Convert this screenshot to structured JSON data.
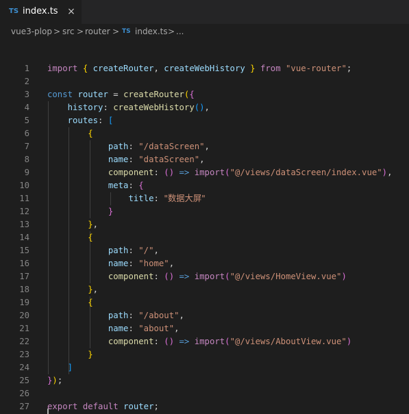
{
  "tab": {
    "badge": "TS",
    "title": "index.ts",
    "close_icon": "×"
  },
  "breadcrumb": {
    "items": [
      "vue3-plop",
      "src",
      "router"
    ],
    "file_badge": "TS",
    "file": "index.ts",
    "trailing": "...",
    "separator": ">"
  },
  "editor": {
    "lines": [
      [
        [
          "t-keyword",
          "import"
        ],
        [
          "t-punct",
          " "
        ],
        [
          "t-brace1",
          "{"
        ],
        [
          "t-punct",
          " "
        ],
        [
          "t-variable",
          "createRouter"
        ],
        [
          "t-punct",
          ", "
        ],
        [
          "t-variable",
          "createWebHistory"
        ],
        [
          "t-punct",
          " "
        ],
        [
          "t-brace1",
          "}"
        ],
        [
          "t-punct",
          " "
        ],
        [
          "t-keyword",
          "from"
        ],
        [
          "t-punct",
          " "
        ],
        [
          "t-string",
          "\"vue-router\""
        ],
        [
          "t-punct",
          ";"
        ]
      ],
      [],
      [
        [
          "t-storage",
          "const"
        ],
        [
          "t-punct",
          " "
        ],
        [
          "t-variable",
          "router"
        ],
        [
          "t-punct",
          " = "
        ],
        [
          "t-function",
          "createRouter"
        ],
        [
          "t-brace1",
          "("
        ],
        [
          "t-brace2",
          "{"
        ]
      ],
      [
        [
          "t-punct",
          "    "
        ],
        [
          "t-variable",
          "history"
        ],
        [
          "t-punct",
          ": "
        ],
        [
          "t-function",
          "createWebHistory"
        ],
        [
          "t-brace3",
          "()"
        ],
        [
          "t-punct",
          ","
        ]
      ],
      [
        [
          "t-punct",
          "    "
        ],
        [
          "t-variable",
          "routes"
        ],
        [
          "t-punct",
          ": "
        ],
        [
          "t-brace3",
          "["
        ]
      ],
      [
        [
          "t-punct",
          "        "
        ],
        [
          "t-brace1",
          "{"
        ]
      ],
      [
        [
          "t-punct",
          "            "
        ],
        [
          "t-variable",
          "path"
        ],
        [
          "t-punct",
          ": "
        ],
        [
          "t-string",
          "\"/dataScreen\""
        ],
        [
          "t-punct",
          ","
        ]
      ],
      [
        [
          "t-punct",
          "            "
        ],
        [
          "t-variable",
          "name"
        ],
        [
          "t-punct",
          ": "
        ],
        [
          "t-string",
          "\"dataScreen\""
        ],
        [
          "t-punct",
          ","
        ]
      ],
      [
        [
          "t-punct",
          "            "
        ],
        [
          "t-function",
          "component"
        ],
        [
          "t-punct",
          ": "
        ],
        [
          "t-brace2",
          "()"
        ],
        [
          "t-punct",
          " "
        ],
        [
          "t-arrow",
          "=>"
        ],
        [
          "t-punct",
          " "
        ],
        [
          "t-keyword",
          "import"
        ],
        [
          "t-brace2",
          "("
        ],
        [
          "t-string",
          "\"@/views/dataScreen/index.vue\""
        ],
        [
          "t-brace2",
          ")"
        ],
        [
          "t-punct",
          ","
        ]
      ],
      [
        [
          "t-punct",
          "            "
        ],
        [
          "t-variable",
          "meta"
        ],
        [
          "t-punct",
          ": "
        ],
        [
          "t-brace2",
          "{"
        ]
      ],
      [
        [
          "t-punct",
          "                "
        ],
        [
          "t-variable",
          "title"
        ],
        [
          "t-punct",
          ": "
        ],
        [
          "t-string t-cjk",
          "\"数据大屏\""
        ]
      ],
      [
        [
          "t-punct",
          "            "
        ],
        [
          "t-brace2",
          "}"
        ]
      ],
      [
        [
          "t-punct",
          "        "
        ],
        [
          "t-brace1",
          "}"
        ],
        [
          "t-punct",
          ","
        ]
      ],
      [
        [
          "t-punct",
          "        "
        ],
        [
          "t-brace1",
          "{"
        ]
      ],
      [
        [
          "t-punct",
          "            "
        ],
        [
          "t-variable",
          "path"
        ],
        [
          "t-punct",
          ": "
        ],
        [
          "t-string",
          "\"/\""
        ],
        [
          "t-punct",
          ","
        ]
      ],
      [
        [
          "t-punct",
          "            "
        ],
        [
          "t-variable",
          "name"
        ],
        [
          "t-punct",
          ": "
        ],
        [
          "t-string",
          "\"home\""
        ],
        [
          "t-punct",
          ","
        ]
      ],
      [
        [
          "t-punct",
          "            "
        ],
        [
          "t-function",
          "component"
        ],
        [
          "t-punct",
          ": "
        ],
        [
          "t-brace2",
          "()"
        ],
        [
          "t-punct",
          " "
        ],
        [
          "t-arrow",
          "=>"
        ],
        [
          "t-punct",
          " "
        ],
        [
          "t-keyword",
          "import"
        ],
        [
          "t-brace2",
          "("
        ],
        [
          "t-string",
          "\"@/views/HomeView.vue\""
        ],
        [
          "t-brace2",
          ")"
        ]
      ],
      [
        [
          "t-punct",
          "        "
        ],
        [
          "t-brace1",
          "}"
        ],
        [
          "t-punct",
          ","
        ]
      ],
      [
        [
          "t-punct",
          "        "
        ],
        [
          "t-brace1",
          "{"
        ]
      ],
      [
        [
          "t-punct",
          "            "
        ],
        [
          "t-variable",
          "path"
        ],
        [
          "t-punct",
          ": "
        ],
        [
          "t-string",
          "\"/about\""
        ],
        [
          "t-punct",
          ","
        ]
      ],
      [
        [
          "t-punct",
          "            "
        ],
        [
          "t-variable",
          "name"
        ],
        [
          "t-punct",
          ": "
        ],
        [
          "t-string",
          "\"about\""
        ],
        [
          "t-punct",
          ","
        ]
      ],
      [
        [
          "t-punct",
          "            "
        ],
        [
          "t-function",
          "component"
        ],
        [
          "t-punct",
          ": "
        ],
        [
          "t-brace2",
          "()"
        ],
        [
          "t-punct",
          " "
        ],
        [
          "t-arrow",
          "=>"
        ],
        [
          "t-punct",
          " "
        ],
        [
          "t-keyword",
          "import"
        ],
        [
          "t-brace2",
          "("
        ],
        [
          "t-string",
          "\"@/views/AboutView.vue\""
        ],
        [
          "t-brace2",
          ")"
        ]
      ],
      [
        [
          "t-punct",
          "        "
        ],
        [
          "t-brace1",
          "}"
        ]
      ],
      [
        [
          "t-punct",
          "    "
        ],
        [
          "t-brace3",
          "]"
        ]
      ],
      [
        [
          "t-brace2",
          "}"
        ],
        [
          "t-brace1",
          ")"
        ],
        [
          "t-punct",
          ";"
        ]
      ],
      [],
      [
        [
          "t-keyword",
          "export"
        ],
        [
          "t-punct",
          " "
        ],
        [
          "t-keyword",
          "default"
        ],
        [
          "t-punct",
          " "
        ],
        [
          "t-variable",
          "router"
        ],
        [
          "t-punct",
          ";"
        ]
      ]
    ]
  },
  "colors": {
    "background": "#1e1e1e",
    "tabbar": "#252526",
    "line_number": "#858585",
    "keyword": "#c586c0",
    "storage": "#569cd6",
    "function": "#dcdcaa",
    "variable": "#9cdcfe",
    "string": "#ce9178",
    "bracket_gold": "#ffd700",
    "bracket_orchid": "#da70d6",
    "bracket_blue": "#179fff",
    "ts_badge": "#3d8fd1"
  }
}
